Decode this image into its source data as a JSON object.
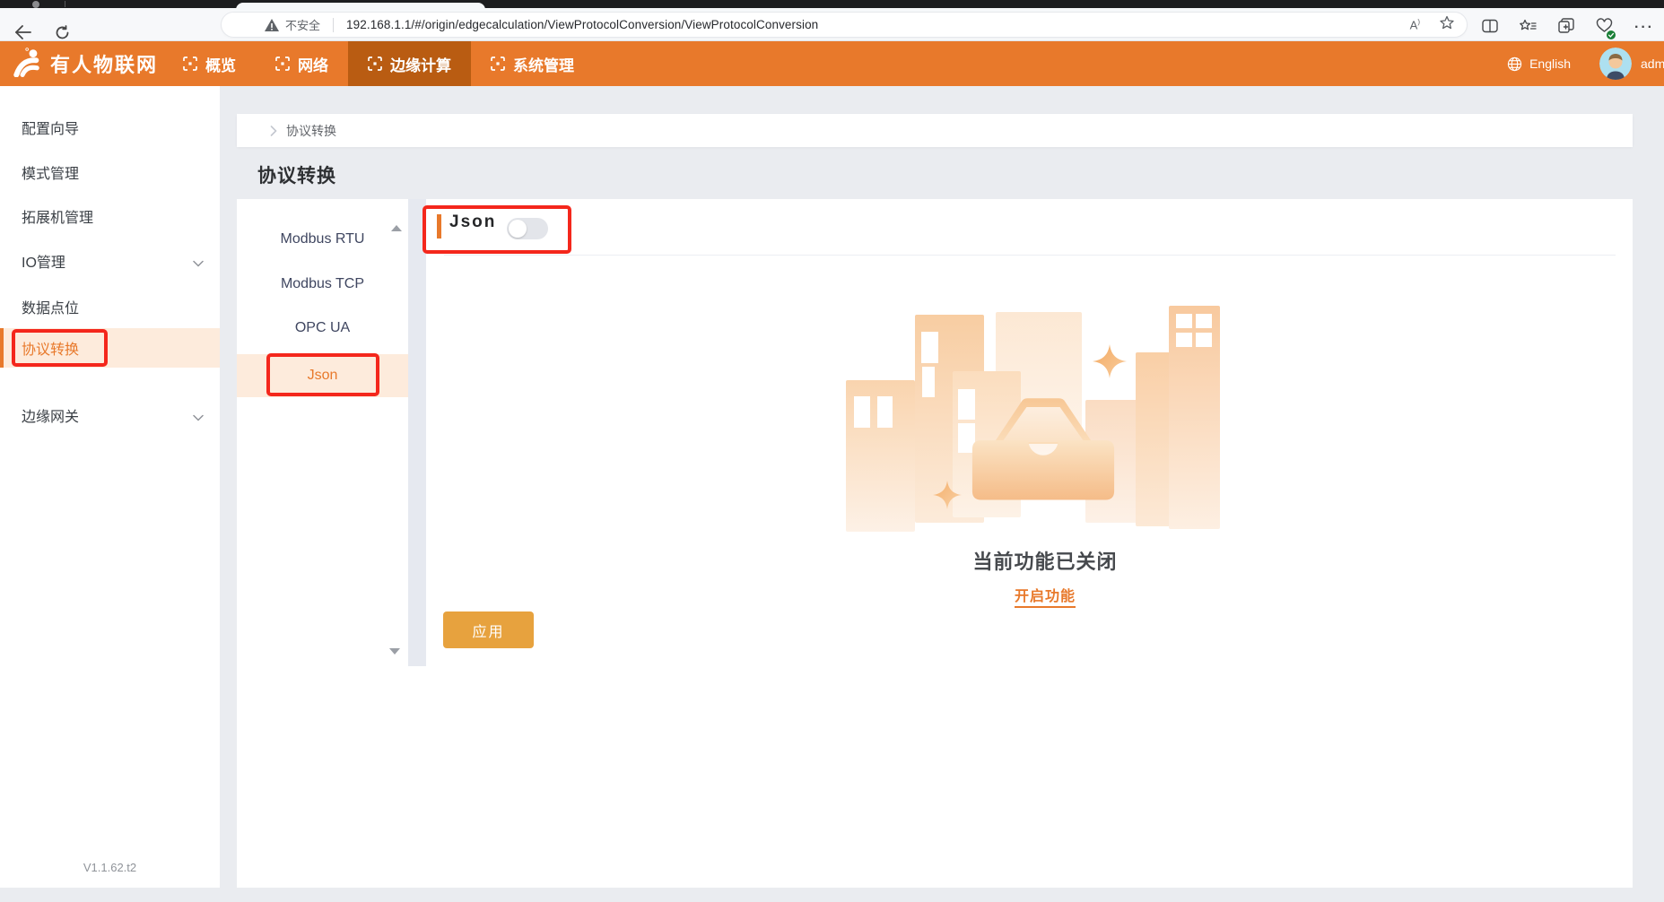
{
  "browser": {
    "security_label": "不安全",
    "url": "192.168.1.1/#/origin/edgecalculation/ViewProtocolConversion/ViewProtocolConversion"
  },
  "nav": {
    "brand": "有人物联网",
    "items": [
      {
        "label": "概览",
        "active": false
      },
      {
        "label": "网络",
        "active": false
      },
      {
        "label": "边缘计算",
        "active": true
      },
      {
        "label": "系统管理",
        "active": false
      }
    ],
    "language": "English",
    "username": "adm"
  },
  "sidebar": {
    "items": [
      {
        "label": "配置向导"
      },
      {
        "label": "模式管理"
      },
      {
        "label": "拓展机管理"
      },
      {
        "label": "IO管理",
        "expandable": true
      },
      {
        "label": "数据点位"
      },
      {
        "label": "协议转换",
        "active": true
      },
      {
        "label": "边缘网关",
        "expandable": true
      }
    ],
    "version": "V1.1.62.t2"
  },
  "breadcrumb": {
    "items": [
      "协议转换"
    ]
  },
  "page": {
    "title": "协议转换"
  },
  "protocol_tabs": {
    "items": [
      {
        "label": "Modbus RTU",
        "active": false
      },
      {
        "label": "Modbus TCP",
        "active": false
      },
      {
        "label": "OPC UA",
        "active": false
      },
      {
        "label": "Json",
        "active": true
      }
    ]
  },
  "content": {
    "section_title": "Json",
    "toggle_state": "off",
    "empty_title": "当前功能已关闭",
    "empty_action": "开启功能",
    "apply_label": "应用"
  },
  "colors": {
    "accent": "#E8792B",
    "nav_active": "#B95C12",
    "annotation_red": "#F4271C",
    "apply_button": "#E7A23E",
    "active_row_bg": "#FDEBDC"
  }
}
